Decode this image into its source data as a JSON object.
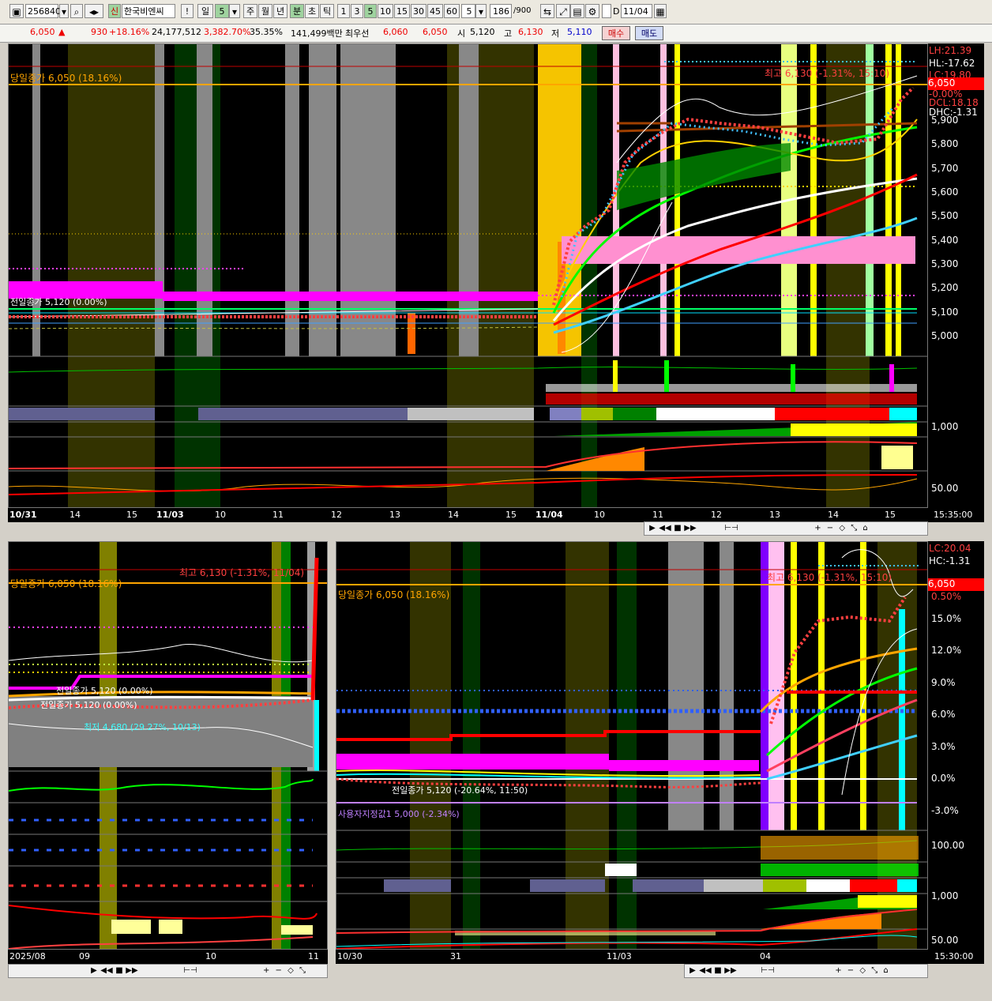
{
  "toolbar": {
    "code": "256840",
    "badge": "신",
    "name": "한국비엔씨",
    "exclaim": "!",
    "period_day": "일",
    "period_day_val": "5",
    "periods": [
      "주",
      "월",
      "년",
      "분",
      "초",
      "틱"
    ],
    "minutes": [
      "1",
      "3",
      "5",
      "10",
      "15",
      "30",
      "45",
      "60"
    ],
    "minute_sel": "5",
    "count": "186",
    "count_total": "/900",
    "date": "11/04",
    "date_prefix": "D"
  },
  "quote": {
    "price": "6,050",
    "arrow": "▲",
    "change": "930",
    "change_pct": "+18.16%",
    "volume": "24,177,512",
    "vol_ratio": "3,382.70%",
    "turnover": "35.35%",
    "amount": "141,499백만",
    "pref_label": "최우선",
    "bid": "6,060",
    "ask": "6,050",
    "open_label": "시",
    "open": "5,120",
    "high_label": "고",
    "high": "6,130",
    "low_label": "저",
    "low": "5,110",
    "buy": "매수",
    "sell": "매도"
  },
  "main_chart": {
    "close_label": "당일종가 6,050 (18.16%)",
    "high_label": "최고 6,130 (-1.31%, 15:10)",
    "prev_close_label": "전일종가 5,120 (0.00%)",
    "price_ticks": [
      "5,900",
      "5,800",
      "5,700",
      "5,600",
      "5,500",
      "5,400",
      "5,300",
      "5,200",
      "5,100",
      "5,000"
    ],
    "right_labels": [
      "LH:21.39",
      "HL:-17.62",
      "LC:19.80",
      "-0.00%",
      "DCL:18.18",
      "DHC:-1.31"
    ],
    "last_price": "6,050",
    "sub_ticks": [
      "1,000",
      "50.00"
    ],
    "x_labels": [
      "10/31",
      "14",
      "15",
      "11/03",
      "10",
      "11",
      "12",
      "13",
      "14",
      "15",
      "11/04",
      "10",
      "11",
      "12",
      "13",
      "14",
      "15"
    ],
    "clock": "15:35:00"
  },
  "daily_chart": {
    "close_label": "당일종가 6,050 (18.16%)",
    "high_label": "최고 6,130 (-1.31%, 11/04)",
    "prev_label": "전일종가 5,120 (0.00%)",
    "prev_label2": "전일종가 5,120 (0.00%)",
    "low_label": "최저 4,680 (29.27%, 10/13)",
    "x_labels": [
      "2025/08",
      "09",
      "10",
      "11"
    ]
  },
  "min_chart": {
    "close_label": "당일종가 6,050 (18.16%)",
    "high_label": "최고 6,130 (-1.31%, 15:10)",
    "prev_label": "전일종가 5,120 (-20.64%, 11:50)",
    "user_label": "사용자지정값1 5,000 (-2.34%)",
    "right_labels": [
      "LC:20.04",
      "HC:-1.31"
    ],
    "last_price": "6,050",
    "last_pct": "0.50%",
    "pct_ticks": [
      "15.0%",
      "12.0%",
      "9.0%",
      "6.0%",
      "3.0%",
      "0.0%",
      "-3.0%"
    ],
    "sub_ticks": [
      "100.00",
      "1,000",
      "50.00"
    ],
    "x_labels": [
      "10/30",
      "31",
      "11/03",
      "04"
    ],
    "clock": "15:30:00"
  }
}
